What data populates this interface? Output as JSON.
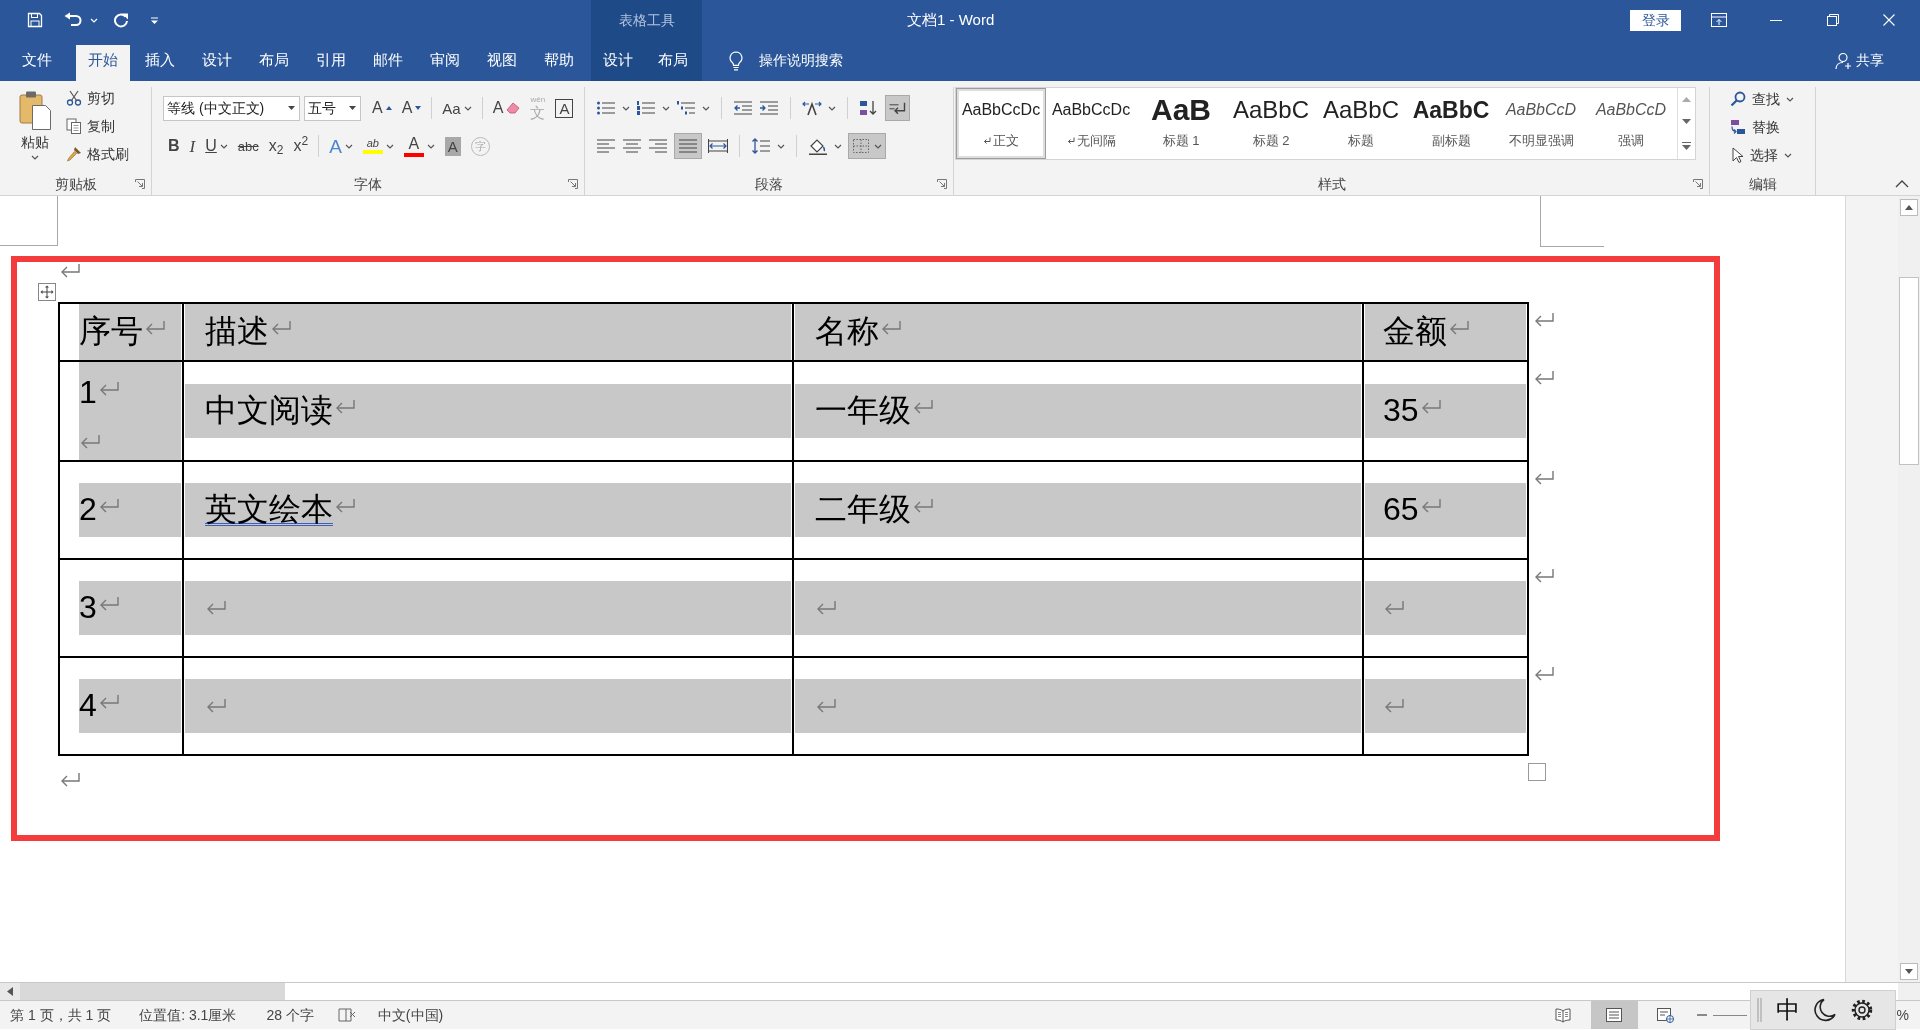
{
  "window": {
    "title": "文档1 - Word",
    "context_title": "表格工具",
    "sign_in": "登录"
  },
  "tabs": [
    {
      "label": "文件",
      "kind": "file",
      "selected": false
    },
    {
      "label": "开始",
      "kind": "main",
      "selected": true
    },
    {
      "label": "插入",
      "kind": "main",
      "selected": false
    },
    {
      "label": "设计",
      "kind": "main",
      "selected": false
    },
    {
      "label": "布局",
      "kind": "main",
      "selected": false
    },
    {
      "label": "引用",
      "kind": "main",
      "selected": false
    },
    {
      "label": "邮件",
      "kind": "main",
      "selected": false
    },
    {
      "label": "审阅",
      "kind": "main",
      "selected": false
    },
    {
      "label": "视图",
      "kind": "main",
      "selected": false
    },
    {
      "label": "帮助",
      "kind": "main",
      "selected": false
    },
    {
      "label": "设计",
      "kind": "context",
      "selected": false
    },
    {
      "label": "布局",
      "kind": "context",
      "selected": false
    }
  ],
  "tell_me": "操作说明搜索",
  "share": "共享",
  "ribbon": {
    "clipboard": {
      "title": "剪贴板",
      "paste": "粘贴",
      "commands": [
        "剪切",
        "复制",
        "格式刷"
      ]
    },
    "font": {
      "title": "字体",
      "font_name": "等线 (中文正文)",
      "font_size": "五号",
      "row1": [
        {
          "kind": "grow",
          "glyph": "A",
          "disabled": false
        },
        {
          "kind": "shrink",
          "glyph": "A",
          "disabled": false
        },
        {
          "kind": "case",
          "glyph": "Aa",
          "disabled": false
        },
        {
          "kind": "clear",
          "glyph": "A",
          "disabled": false
        },
        {
          "kind": "phonetic",
          "glyph": "文",
          "ruby": "wén",
          "disabled": true
        },
        {
          "kind": "border",
          "glyph": "A",
          "disabled": false
        }
      ],
      "row2": [
        {
          "kind": "bold",
          "glyph": "B",
          "disabled": false
        },
        {
          "kind": "italic",
          "glyph": "I",
          "disabled": false
        },
        {
          "kind": "underline",
          "glyph": "U",
          "disabled": false
        },
        {
          "kind": "strike",
          "glyph": "abc",
          "disabled": false
        },
        {
          "kind": "sub",
          "glyph": "x$_{2}$",
          "disabled": false
        },
        {
          "kind": "sup",
          "glyph": "x$^{2}$",
          "disabled": false
        },
        {
          "kind": "effects",
          "glyph": "A",
          "disabled": false
        },
        {
          "kind": "highlight",
          "glyph": "ab",
          "color": "#ffff00",
          "disabled": false
        },
        {
          "kind": "color",
          "glyph": "A",
          "color": "#ff0000",
          "disabled": false
        },
        {
          "kind": "shading",
          "glyph": "A",
          "disabled": false
        },
        {
          "kind": "enclose",
          "glyph": "字",
          "disabled": true
        }
      ]
    },
    "paragraph": {
      "title": "段落",
      "show_marks_on": true,
      "justify_on": true,
      "borders_on": true
    },
    "styles": {
      "title": "样式",
      "items": [
        {
          "preview": "AaBbCcDc",
          "label": "正文",
          "kind": "normal",
          "paragraph_mark": true,
          "selected": true
        },
        {
          "preview": "AaBbCcDc",
          "label": "无间隔",
          "kind": "normal",
          "paragraph_mark": true,
          "selected": false
        },
        {
          "preview": "AaB",
          "label": "标题 1",
          "kind": "heading1",
          "paragraph_mark": false,
          "selected": false
        },
        {
          "preview": "AaBbC",
          "label": "标题 2",
          "kind": "heading2",
          "paragraph_mark": false,
          "selected": false
        },
        {
          "preview": "AaBbC",
          "label": "标题",
          "kind": "title",
          "paragraph_mark": false,
          "selected": false
        },
        {
          "preview": "AaBbC",
          "label": "副标题",
          "kind": "subtitle",
          "paragraph_mark": false,
          "selected": false
        },
        {
          "preview": "AaBbCcD",
          "label": "不明显强调",
          "kind": "emphasis",
          "paragraph_mark": false,
          "selected": false
        },
        {
          "preview": "AaBbCcD",
          "label": "强调",
          "kind": "emphasis",
          "paragraph_mark": false,
          "selected": false
        }
      ]
    },
    "editing": {
      "title": "编辑",
      "commands": [
        {
          "label": "查找",
          "kind": "find"
        },
        {
          "label": "替换",
          "kind": "replace"
        },
        {
          "label": "选择",
          "kind": "select"
        }
      ]
    }
  },
  "document": {
    "table": {
      "selected": true,
      "columns": [
        "序号",
        "描述",
        "名称",
        "金额"
      ],
      "rows": [
        [
          {
            "text": "1",
            "blank_line": true,
            "flagged": false
          },
          {
            "text": "中文阅读",
            "blank_line": false,
            "flagged": false
          },
          {
            "text": "一年级",
            "blank_line": false,
            "flagged": false
          },
          {
            "text": "35",
            "blank_line": false,
            "flagged": false
          }
        ],
        [
          {
            "text": "2",
            "blank_line": false,
            "flagged": false
          },
          {
            "text": "英文绘本",
            "blank_line": false,
            "flagged": true
          },
          {
            "text": "二年级",
            "blank_line": false,
            "flagged": false
          },
          {
            "text": "65",
            "blank_line": false,
            "flagged": false
          }
        ],
        [
          {
            "text": "3",
            "blank_line": false,
            "flagged": false
          },
          {
            "blank_line": false,
            "flagged": false
          },
          {
            "blank_line": false,
            "flagged": false
          },
          {
            "blank_line": false,
            "flagged": false
          }
        ],
        [
          {
            "text": "4",
            "blank_line": false,
            "flagged": false
          },
          {
            "blank_line": false,
            "flagged": false
          },
          {
            "blank_line": false,
            "flagged": false
          },
          {
            "blank_line": false,
            "flagged": false
          }
        ]
      ]
    }
  },
  "status_bar": {
    "page": "第 1 页，共 1 页",
    "position": "位置值: 3.1厘米",
    "words": "28 个字",
    "language": "中文(中国)",
    "views": [
      {
        "kind": "read",
        "selected": false
      },
      {
        "kind": "print",
        "selected": true
      },
      {
        "kind": "web",
        "selected": false
      }
    ],
    "zoom": "%"
  },
  "ime": {
    "mode": "中"
  }
}
